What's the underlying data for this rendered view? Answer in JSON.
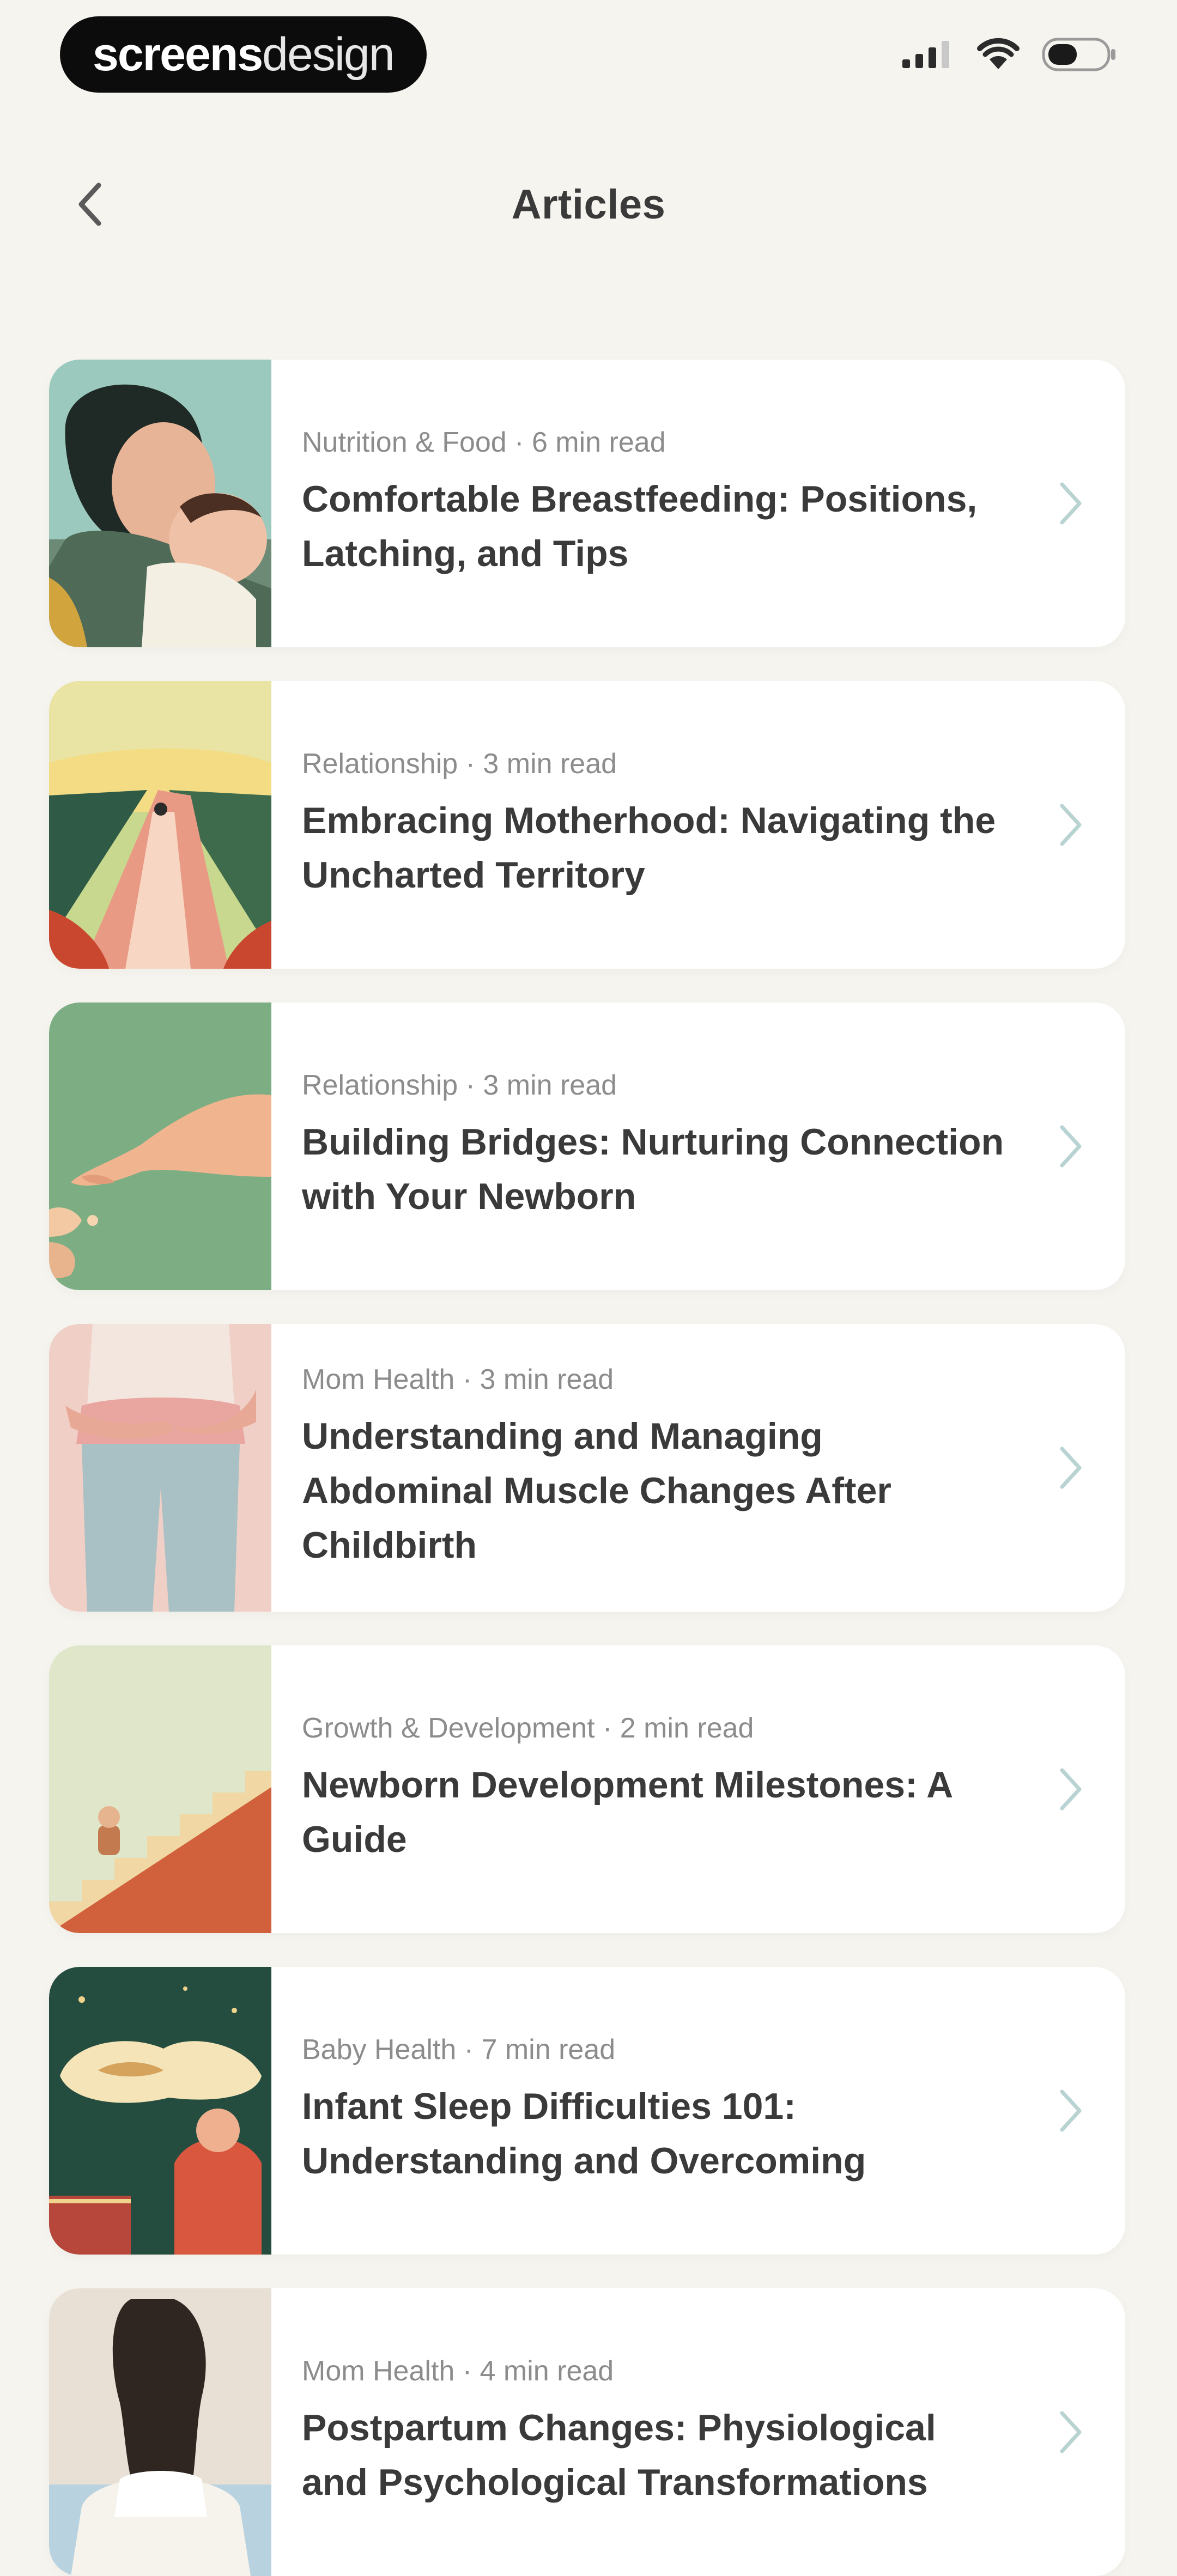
{
  "status_bar": {
    "brand_strong": "screens",
    "brand_light": "design"
  },
  "header": {
    "title": "Articles"
  },
  "articles": [
    {
      "meta": "Nutrition & Food · 6 min read",
      "title": "Comfortable Breastfeeding: Positions, Latching, and Tips"
    },
    {
      "meta": "Relationship · 3 min read",
      "title": "Embracing Motherhood: Navigating the Uncharted Territory"
    },
    {
      "meta": "Relationship · 3 min read",
      "title": "Building Bridges: Nurturing Connection with Your Newborn"
    },
    {
      "meta": "Mom Health · 3 min read",
      "title": "Understanding and Managing Abdominal Muscle Changes After Childbirth"
    },
    {
      "meta": "Growth & Development · 2 min read",
      "title": "Newborn Development Milestones: A Guide"
    },
    {
      "meta": "Baby Health · 7 min read",
      "title": "Infant Sleep Difficulties 101: Understanding and Overcoming"
    },
    {
      "meta": "Mom Health · 4 min read",
      "title": "Postpartum Changes: Physiological and Psychological Transformations"
    }
  ],
  "colors": {
    "background": "#f6f4ef",
    "card": "#ffffff",
    "chevron": "#b9d3d3",
    "meta_text": "#8c8c8c",
    "title_text": "#3a3a3a"
  },
  "icons": {
    "back": "chevron-left-icon",
    "row": "chevron-right-icon",
    "signal": "signal-icon",
    "wifi": "wifi-icon",
    "battery": "battery-icon"
  }
}
